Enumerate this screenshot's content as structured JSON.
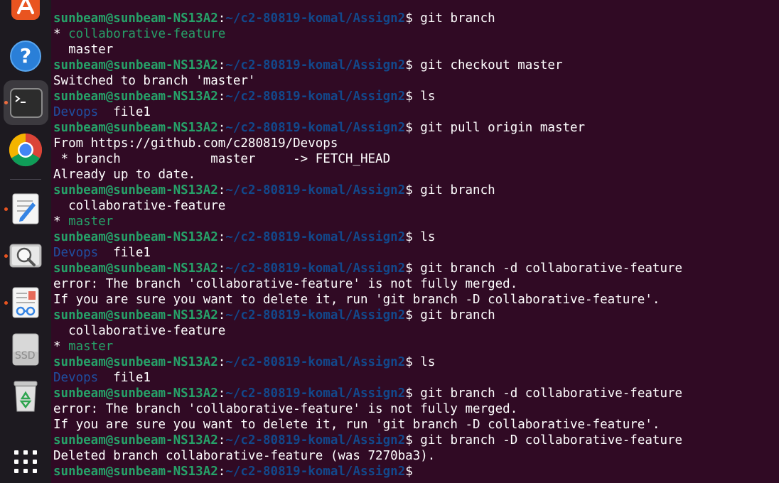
{
  "dock": {
    "items": [
      {
        "name": "app-center",
        "icon": "app-center-icon",
        "running": false,
        "active": false
      },
      {
        "name": "help",
        "icon": "help-icon",
        "running": false,
        "active": false
      },
      {
        "name": "terminal",
        "icon": "terminal-icon",
        "running": true,
        "active": true
      },
      {
        "name": "chrome",
        "icon": "chrome-icon",
        "running": false,
        "active": false
      },
      {
        "name": "text-editor",
        "icon": "text-editor-icon",
        "running": true,
        "active": false
      },
      {
        "name": "image-viewer",
        "icon": "image-viewer-icon",
        "running": true,
        "active": false
      },
      {
        "name": "document-viewer",
        "icon": "document-viewer-icon",
        "running": true,
        "active": false
      },
      {
        "name": "ssd-drive",
        "icon": "ssd-drive-icon",
        "running": false,
        "active": false,
        "label": "SSD"
      },
      {
        "name": "trash",
        "icon": "trash-icon",
        "running": false,
        "active": false
      },
      {
        "name": "show-apps",
        "icon": "app-grid-icon",
        "running": false,
        "active": false
      }
    ]
  },
  "terminal": {
    "prompt_user": "sunbeam@sunbeam-NS13A2",
    "prompt_sep": ":",
    "prompt_path": "~/c2-80819-komal/Assign2",
    "prompt_symbol": "$",
    "colors": {
      "background": "#300a24",
      "user": "#26a269",
      "path": "#12488b",
      "text": "#ffffff",
      "current_branch": "#26a269",
      "directory": "#1f4fa1"
    },
    "lines": [
      {
        "type": "prompt",
        "cmd": " git branch"
      },
      {
        "type": "text",
        "parts": [
          {
            "t": "* "
          },
          {
            "t": "collaborative-feature",
            "c": "cur"
          }
        ]
      },
      {
        "type": "text",
        "parts": [
          {
            "t": "  master"
          }
        ]
      },
      {
        "type": "prompt",
        "cmd": " git checkout master"
      },
      {
        "type": "text",
        "parts": [
          {
            "t": "Switched to branch 'master'"
          }
        ]
      },
      {
        "type": "prompt",
        "cmd": " ls"
      },
      {
        "type": "text",
        "parts": [
          {
            "t": "Devops",
            "c": "dir"
          },
          {
            "t": "  file1"
          }
        ]
      },
      {
        "type": "prompt",
        "cmd": " git pull origin master"
      },
      {
        "type": "text",
        "parts": [
          {
            "t": "From https://github.com/c280819/Devops"
          }
        ]
      },
      {
        "type": "text",
        "parts": [
          {
            "t": " * branch            master     -> FETCH_HEAD"
          }
        ]
      },
      {
        "type": "text",
        "parts": [
          {
            "t": "Already up to date."
          }
        ]
      },
      {
        "type": "prompt",
        "cmd": " git branch"
      },
      {
        "type": "text",
        "parts": [
          {
            "t": "  collaborative-feature"
          }
        ]
      },
      {
        "type": "text",
        "parts": [
          {
            "t": "* "
          },
          {
            "t": "master",
            "c": "cur"
          }
        ]
      },
      {
        "type": "prompt",
        "cmd": " ls"
      },
      {
        "type": "text",
        "parts": [
          {
            "t": "Devops",
            "c": "dir"
          },
          {
            "t": "  file1"
          }
        ]
      },
      {
        "type": "prompt",
        "cmd": " git branch -d collaborative-feature"
      },
      {
        "type": "text",
        "parts": [
          {
            "t": "error: The branch 'collaborative-feature' is not fully merged."
          }
        ]
      },
      {
        "type": "text",
        "parts": [
          {
            "t": "If you are sure you want to delete it, run 'git branch -D collaborative-feature'."
          }
        ]
      },
      {
        "type": "prompt",
        "cmd": " git branch"
      },
      {
        "type": "text",
        "parts": [
          {
            "t": "  collaborative-feature"
          }
        ]
      },
      {
        "type": "text",
        "parts": [
          {
            "t": "* "
          },
          {
            "t": "master",
            "c": "cur"
          }
        ]
      },
      {
        "type": "prompt",
        "cmd": " ls"
      },
      {
        "type": "text",
        "parts": [
          {
            "t": "Devops",
            "c": "dir"
          },
          {
            "t": "  file1"
          }
        ]
      },
      {
        "type": "prompt",
        "cmd": " git branch -d collaborative-feature"
      },
      {
        "type": "text",
        "parts": [
          {
            "t": "error: The branch 'collaborative-feature' is not fully merged."
          }
        ]
      },
      {
        "type": "text",
        "parts": [
          {
            "t": "If you are sure you want to delete it, run 'git branch -D collaborative-feature'."
          }
        ]
      },
      {
        "type": "prompt",
        "cmd": " git branch -D collaborative-feature"
      },
      {
        "type": "text",
        "parts": [
          {
            "t": "Deleted branch collaborative-feature (was 7270ba3)."
          }
        ]
      },
      {
        "type": "prompt",
        "cmd": ""
      }
    ]
  }
}
